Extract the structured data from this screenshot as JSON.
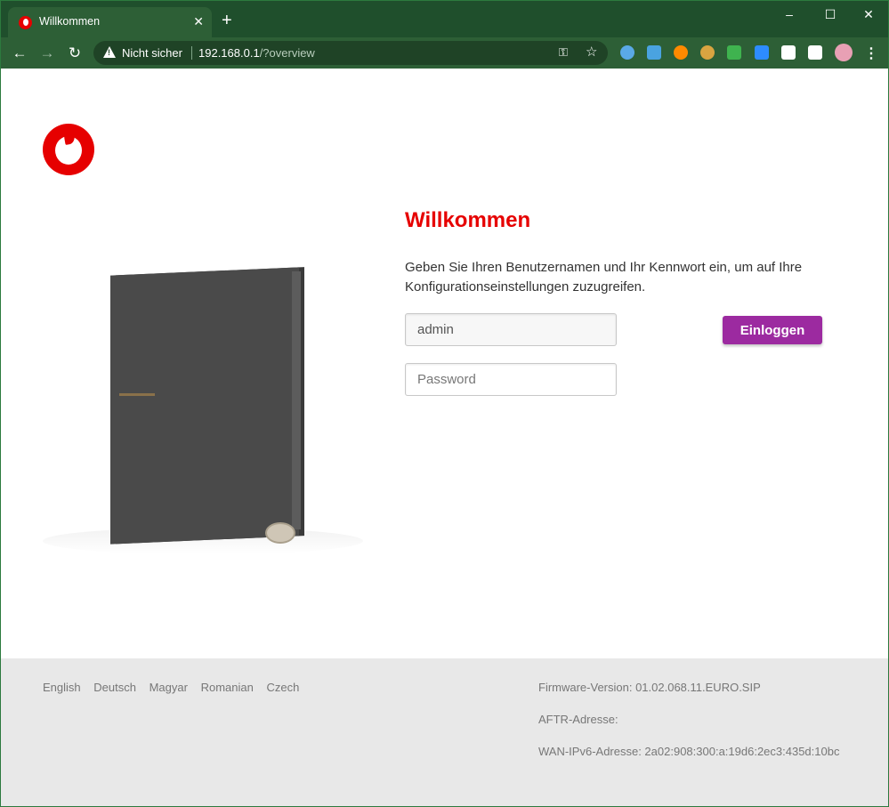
{
  "browser": {
    "tab_title": "Willkommen",
    "tab_close": "✕",
    "new_tab": "+",
    "security_label": "Nicht sicher",
    "url_host": "192.168.0.1",
    "url_path": "/?overview",
    "controls": {
      "minimize": "–",
      "maximize": "☐",
      "close": "✕"
    },
    "nav": {
      "back": "←",
      "forward": "→",
      "reload": "↻"
    },
    "menu": "⋮",
    "extension_colors": [
      "#5aa9e6",
      "#4aa3e0",
      "#ff8a00",
      "#d9a441",
      "#3fb34f",
      "#2d8cff",
      "#ffffff",
      "#ffffff",
      "#e8a0b4"
    ]
  },
  "page": {
    "heading": "Willkommen",
    "intro": "Geben Sie Ihren Benutzernamen und Ihr Kennwort ein, um auf Ihre Konfigurationseinstellungen zuzugreifen.",
    "username_value": "admin",
    "password_placeholder": "Password",
    "login_label": "Einloggen"
  },
  "footer": {
    "languages": [
      "English",
      "Deutsch",
      "Magyar",
      "Romanian",
      "Czech"
    ],
    "firmware": "Firmware-Version: 01.02.068.11.EURO.SIP",
    "aftr": "AFTR-Adresse:",
    "wan_ipv6": "WAN-IPv6-Adresse: 2a02:908:300:a:19d6:2ec3:435d:10bc"
  },
  "colors": {
    "brand_red": "#e60000",
    "login_purple": "#9c2aa0",
    "chrome_green": "#2d5f36"
  }
}
